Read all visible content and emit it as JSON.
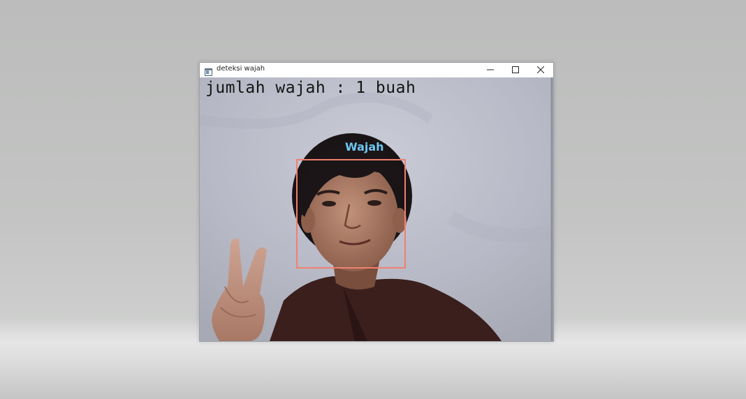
{
  "window": {
    "title": "deteksi wajah",
    "controls": {
      "minimize_icon": "minimize-icon",
      "maximize_icon": "maximize-icon",
      "close_icon": "close-icon"
    }
  },
  "video_frame": {
    "count_text": "jumlah wajah : 1 buah",
    "detections": [
      {
        "label": "Wajah",
        "box_color": "#f08070",
        "label_color": "#6ec6f0"
      }
    ]
  },
  "colors": {
    "wall": "#b9bccb",
    "title_bar": "#ffffff",
    "count_text": "#141414"
  }
}
